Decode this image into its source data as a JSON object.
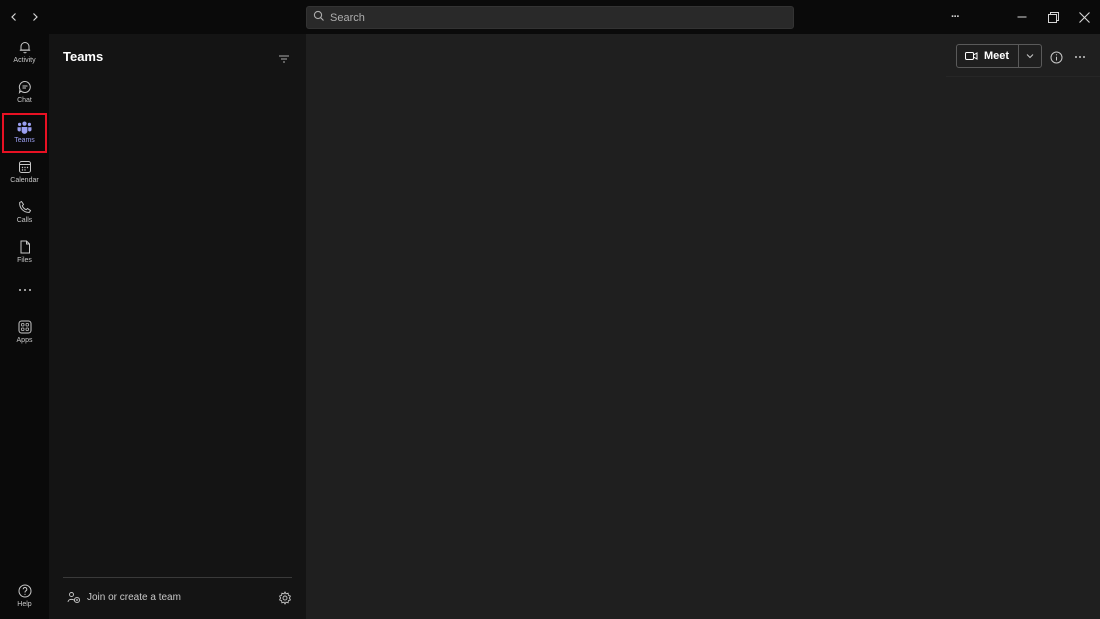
{
  "titlebar": {
    "search_placeholder": "Search",
    "more_glyph": "···"
  },
  "rail": {
    "items": [
      {
        "label": "Activity",
        "icon": "bell-icon"
      },
      {
        "label": "Chat",
        "icon": "chat-icon"
      },
      {
        "label": "Teams",
        "icon": "teams-icon",
        "active": true
      },
      {
        "label": "Calendar",
        "icon": "calendar-icon"
      },
      {
        "label": "Calls",
        "icon": "phone-icon"
      },
      {
        "label": "Files",
        "icon": "file-icon"
      },
      {
        "label": "Apps",
        "icon": "apps-icon"
      }
    ],
    "help_label": "Help"
  },
  "list_pane": {
    "title": "Teams",
    "join_label": "Join or create a team"
  },
  "main": {
    "meet_label": "Meet"
  },
  "colors": {
    "rail_bg": "#0a0a0a",
    "pane_bg": "#141414",
    "main_bg": "#1f1f1f",
    "accent": "#9b9ff0",
    "highlight_box": "#e81123"
  }
}
